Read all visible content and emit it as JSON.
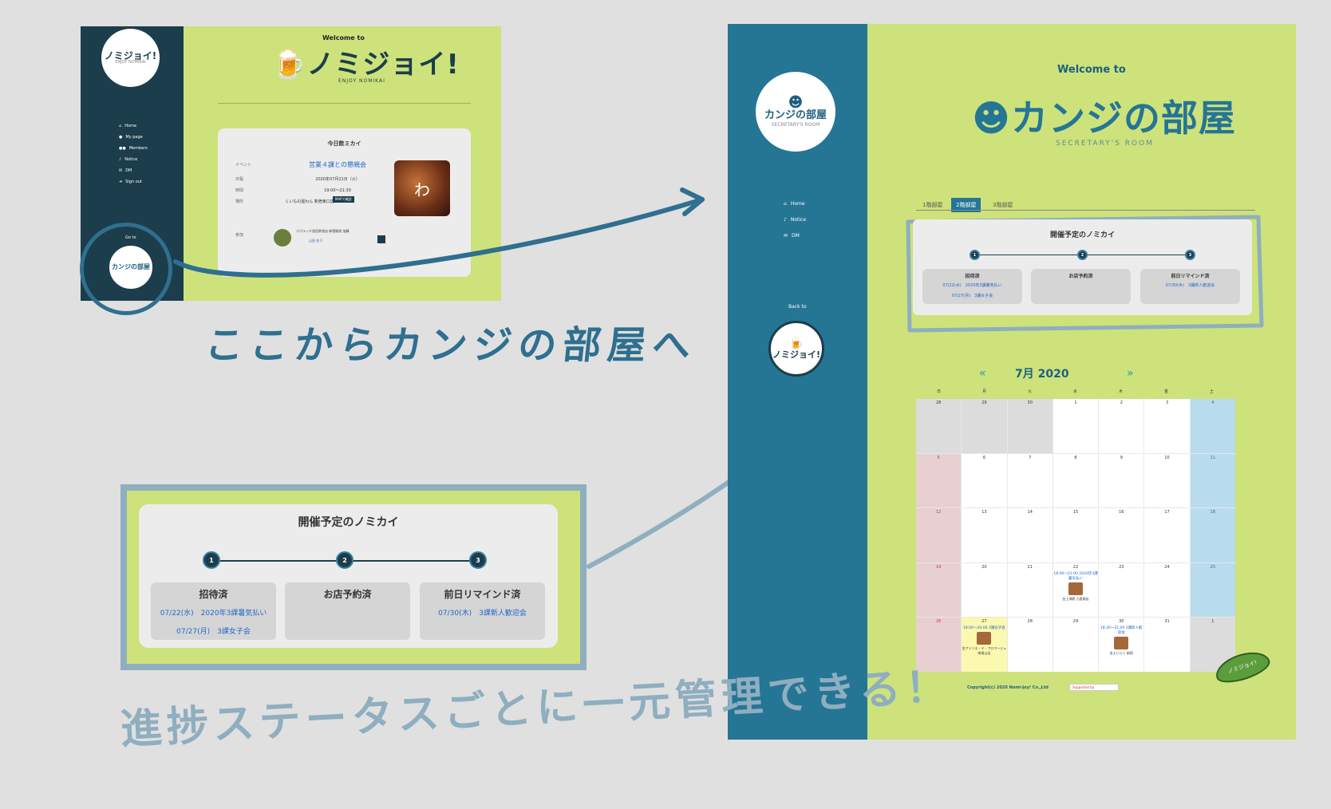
{
  "annotations": {
    "arrow_caption": "ここからカンジの部屋へ",
    "bottom_caption": "進捗ステータスごとに一元管理できる！"
  },
  "small_screen": {
    "logo_text": "ノミジョイ!",
    "logo_sub": "ENJOY NOMIKAI",
    "nav": [
      {
        "icon": "home-icon",
        "label": "Home"
      },
      {
        "icon": "user-icon",
        "label": "My page"
      },
      {
        "icon": "members-icon",
        "label": "Members"
      },
      {
        "icon": "bell-icon",
        "label": "Notice"
      },
      {
        "icon": "mail-icon",
        "label": "DM"
      },
      {
        "icon": "signout-icon",
        "label": "Sign out"
      }
    ],
    "back_to": "Go to",
    "kanji_badge": "カンジの部屋",
    "welcome": "Welcome to",
    "title": "ノミジョイ!",
    "subtitle": "ENJOY NOMIKAI",
    "card_title": "今日飲ミカイ",
    "rows": [
      {
        "label": "イベント",
        "value": "営業４課との懇親会"
      },
      {
        "label": "日程",
        "value": "2020年07月21日（火）"
      },
      {
        "label": "時間",
        "value": "19:00〜21:30"
      },
      {
        "label": "場所",
        "value": "くいもの屋わん 新宿東口店"
      }
    ],
    "map_button": "MAPで確認",
    "member_label": "参加",
    "member_note": "パパラッチ池田茶池店 新宿駅前 加藤",
    "avatar_label": "山田 花子"
  },
  "big_screen": {
    "logo_text": "カンジの部屋",
    "logo_sub": "SECRETARY'S ROOM",
    "nav": [
      {
        "icon": "home-icon",
        "label": "Home"
      },
      {
        "icon": "bell-icon",
        "label": "Notice"
      },
      {
        "icon": "mail-icon",
        "label": "DM"
      }
    ],
    "back_to": "Back to",
    "nomi_badge": "ノミジョイ!",
    "welcome": "Welcome to",
    "title": "カンジの部屋",
    "subtitle": "SECRETARY'S ROOM",
    "tabs": [
      "1階部屋",
      "2階部屋",
      "3階部屋"
    ],
    "active_tab": 1,
    "card_title": "開催予定のノミカイ",
    "steps": [
      {
        "num": "1",
        "label": "招待済",
        "items": [
          "07/22(水)　2020年3課暑気払い",
          "07/27(月)　3課女子会"
        ]
      },
      {
        "num": "2",
        "label": "お店予約済",
        "items": []
      },
      {
        "num": "3",
        "label": "前日リマインド済",
        "items": [
          "07/30(木)　3課新人歓迎会"
        ]
      }
    ],
    "calendar": {
      "prev": "«",
      "month": "7月 2020",
      "next": "»",
      "dow": [
        "日",
        "月",
        "火",
        "水",
        "木",
        "金",
        "土"
      ],
      "weeks": [
        [
          {
            "d": "28",
            "t": "gray"
          },
          {
            "d": "29",
            "t": "gray"
          },
          {
            "d": "30",
            "t": "gray"
          },
          {
            "d": "1"
          },
          {
            "d": "2"
          },
          {
            "d": "3"
          },
          {
            "d": "4",
            "t": "sat"
          }
        ],
        [
          {
            "d": "5",
            "t": "sun"
          },
          {
            "d": "6"
          },
          {
            "d": "7"
          },
          {
            "d": "8"
          },
          {
            "d": "9"
          },
          {
            "d": "10"
          },
          {
            "d": "11",
            "t": "sat"
          }
        ],
        [
          {
            "d": "12",
            "t": "sun"
          },
          {
            "d": "13"
          },
          {
            "d": "14"
          },
          {
            "d": "15"
          },
          {
            "d": "16"
          },
          {
            "d": "17"
          },
          {
            "d": "18",
            "t": "sat"
          }
        ],
        [
          {
            "d": "19",
            "t": "sun"
          },
          {
            "d": "20"
          },
          {
            "d": "21"
          },
          {
            "d": "22",
            "ev": "18:00〜21:00 2020年3課暑気払い",
            "pic": true,
            "shop": "金上海館 九段南店"
          },
          {
            "d": "23"
          },
          {
            "d": "24"
          },
          {
            "d": "25",
            "t": "sat"
          }
        ],
        [
          {
            "d": "26",
            "t": "sun"
          },
          {
            "d": "27",
            "t": "today",
            "ev": "18:00〜20:00 3課女子会",
            "pic": true,
            "shop": "金アトリエ・ド・フロマージュ 南青山店"
          },
          {
            "d": "28"
          },
          {
            "d": "29"
          },
          {
            "d": "30",
            "ev": "18:30〜21:00 3課新人歓迎会",
            "pic": true,
            "shop": "金えいらく 新宿"
          },
          {
            "d": "31"
          },
          {
            "d": "1",
            "t": "gray"
          }
        ]
      ]
    },
    "copyright": "Copyright(c) 2020 Nomi-Joy! Co.,Ltd",
    "banner": "Supported by",
    "pea_label": "ノミジョイ!"
  },
  "colors": {
    "background": "#e0e0e0",
    "lime": "#cde27a",
    "small_sidebar": "#1c3d4b",
    "big_sidebar": "#257595",
    "link": "#2367c8",
    "handwriting_dark": "#2f6f8f",
    "handwriting_light": "#8faec0"
  }
}
